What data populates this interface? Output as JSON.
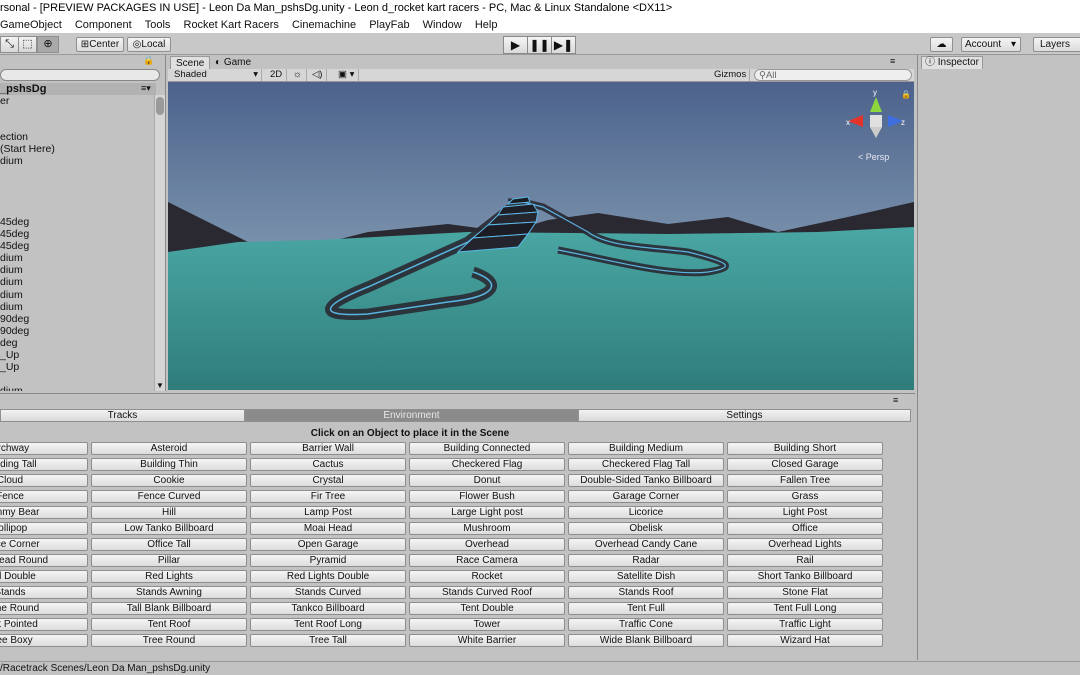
{
  "window": {
    "title": "rsonal - [PREVIEW PACKAGES IN USE] - Leon Da Man_pshsDg.unity - Leon d_rocket kart racers - PC, Mac & Linux Standalone <DX11>"
  },
  "menu": [
    "GameObject",
    "Component",
    "Tools",
    "Rocket Kart Racers",
    "Cinemachine",
    "PlayFab",
    "Window",
    "Help"
  ],
  "toolbar": {
    "pivot_label": "Center",
    "space_label": "Local",
    "account_label": "Account",
    "layers_label": "Layers"
  },
  "hierarchy": {
    "scene_name": "_pshsDg",
    "rows": [
      "er",
      "",
      "",
      "ection",
      "(Start Here)",
      "dium",
      "",
      "",
      "",
      "",
      "45deg",
      "45deg",
      "45deg",
      "dium",
      "dium",
      "dium",
      "dium",
      "dium",
      "90deg",
      "90deg",
      "deg",
      "_Up",
      "_Up",
      "",
      "dium"
    ]
  },
  "scene_view": {
    "tabs": [
      "Scene",
      "Game"
    ],
    "shading": "Shaded",
    "mode_2d": "2D",
    "gizmos": "Gizmos",
    "search_placeholder": "All",
    "persp_label": "< Persp"
  },
  "inspector": {
    "tab": "Inspector"
  },
  "panel": {
    "tabs": [
      "Tracks",
      "Environment",
      "Settings"
    ],
    "heading": "Click on an Object to place it in the Scene",
    "objects": [
      "Archway",
      "Asteroid",
      "Barrier Wall",
      "Building Connected",
      "Building Medium",
      "Building Short",
      "Building Tall",
      "Building Thin",
      "Cactus",
      "Checkered Flag",
      "Checkered Flag Tall",
      "Closed Garage",
      "Cloud",
      "Cookie",
      "Crystal",
      "Donut",
      "Double-Sided Tanko Billboard",
      "Fallen Tree",
      "Fence",
      "Fence Curved",
      "Fir Tree",
      "Flower Bush",
      "Garage Corner",
      "Grass",
      "Gummy Bear",
      "Hill",
      "Lamp Post",
      "Large Light post",
      "Licorice",
      "Light Post",
      "Lollipop",
      "Low Tanko Billboard",
      "Moai Head",
      "Mushroom",
      "Obelisk",
      "Office",
      "Office Corner",
      "Office Tall",
      "Open Garage",
      "Overhead",
      "Overhead Candy Cane",
      "Overhead Lights",
      "Overhead Round",
      "Pillar",
      "Pyramid",
      "Race Camera",
      "Radar",
      "Rail",
      "Rail Double",
      "Red Lights",
      "Red Lights Double",
      "Rocket",
      "Satellite Dish",
      "Short Tanko Billboard",
      "Stands",
      "Stands Awning",
      "Stands Curved",
      "Stands Curved Roof",
      "Stands Roof",
      "Stone Flat",
      "Stone Round",
      "Tall Blank Billboard",
      "Tankco Billboard",
      "Tent Double",
      "Tent Full",
      "Tent Full Long",
      "Tent Pointed",
      "Tent Roof",
      "Tent Roof Long",
      "Tower",
      "Traffic Cone",
      "Traffic Light",
      "Tree Boxy",
      "Tree Round",
      "Tree Tall",
      "White Barrier",
      "Wide Blank Billboard",
      "Wizard Hat"
    ]
  },
  "status": {
    "path": "/Racetrack Scenes/Leon Da Man_pshsDg.unity"
  },
  "colors": {
    "accent": "#5db8e8",
    "sky_top": "#4c628c",
    "ground": "#3e8d8a"
  }
}
